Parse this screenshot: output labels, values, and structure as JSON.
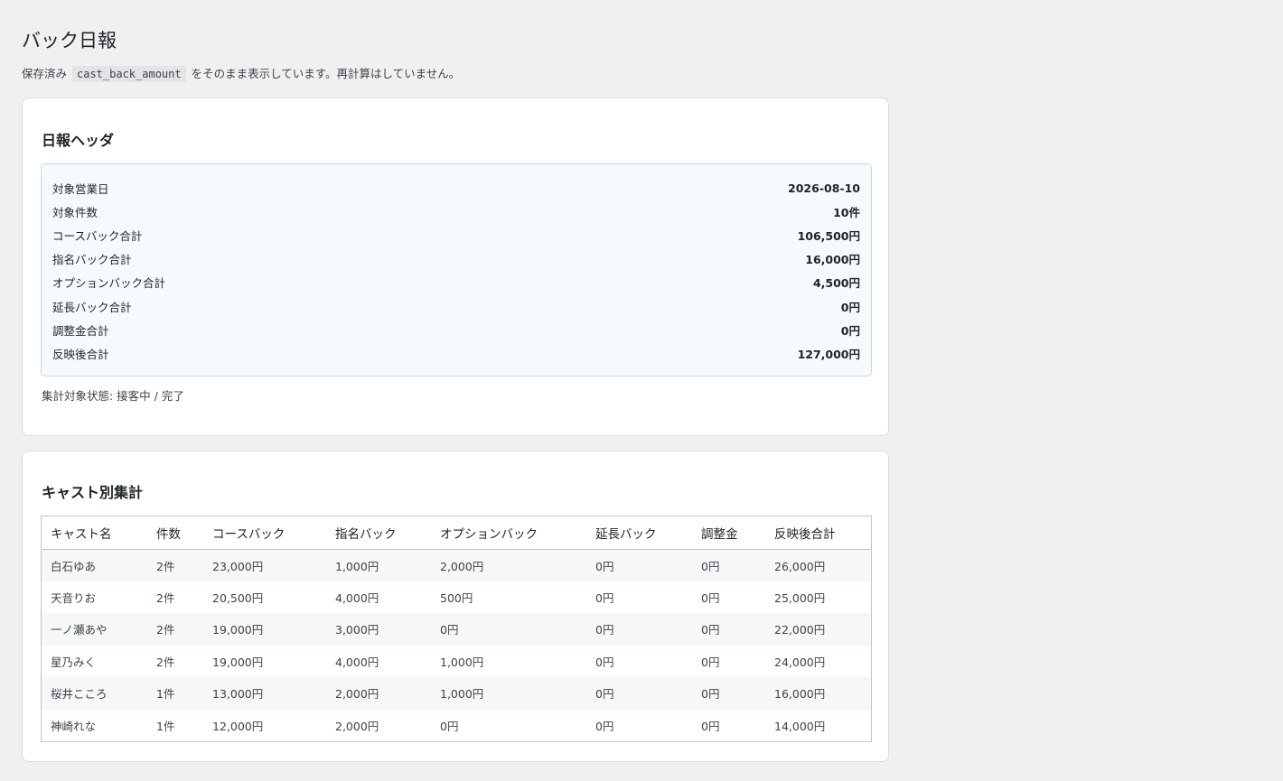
{
  "page": {
    "title": "バック日報",
    "description_before": "保存済み",
    "description_code": "cast_back_amount",
    "description_after": "をそのまま表示しています。再計算はしていません。"
  },
  "header_card": {
    "title": "日報ヘッダ",
    "rows": [
      {
        "label": "対象営業日",
        "value": "2026-08-10"
      },
      {
        "label": "対象件数",
        "value": "10件"
      },
      {
        "label": "コースバック合計",
        "value": "106,500円"
      },
      {
        "label": "指名バック合計",
        "value": "16,000円"
      },
      {
        "label": "オプションバック合計",
        "value": "4,500円"
      },
      {
        "label": "延長バック合計",
        "value": "0円"
      },
      {
        "label": "調整金合計",
        "value": "0円"
      },
      {
        "label": "反映後合計",
        "value": "127,000円"
      }
    ],
    "footnote": "集計対象状態: 接客中 / 完了"
  },
  "cast_card": {
    "title": "キャスト別集計",
    "columns": [
      "キャスト名",
      "件数",
      "コースバック",
      "指名バック",
      "オプションバック",
      "延長バック",
      "調整金",
      "反映後合計"
    ],
    "rows": [
      [
        "白石ゆあ",
        "2件",
        "23,000円",
        "1,000円",
        "2,000円",
        "0円",
        "0円",
        "26,000円"
      ],
      [
        "天音りお",
        "2件",
        "20,500円",
        "4,000円",
        "500円",
        "0円",
        "0円",
        "25,000円"
      ],
      [
        "一ノ瀬あや",
        "2件",
        "19,000円",
        "3,000円",
        "0円",
        "0円",
        "0円",
        "22,000円"
      ],
      [
        "星乃みく",
        "2件",
        "19,000円",
        "4,000円",
        "1,000円",
        "0円",
        "0円",
        "24,000円"
      ],
      [
        "桜井こころ",
        "1件",
        "13,000円",
        "2,000円",
        "1,000円",
        "0円",
        "0円",
        "16,000円"
      ],
      [
        "神崎れな",
        "1件",
        "12,000円",
        "2,000円",
        "0円",
        "0円",
        "0円",
        "14,000円"
      ]
    ]
  }
}
